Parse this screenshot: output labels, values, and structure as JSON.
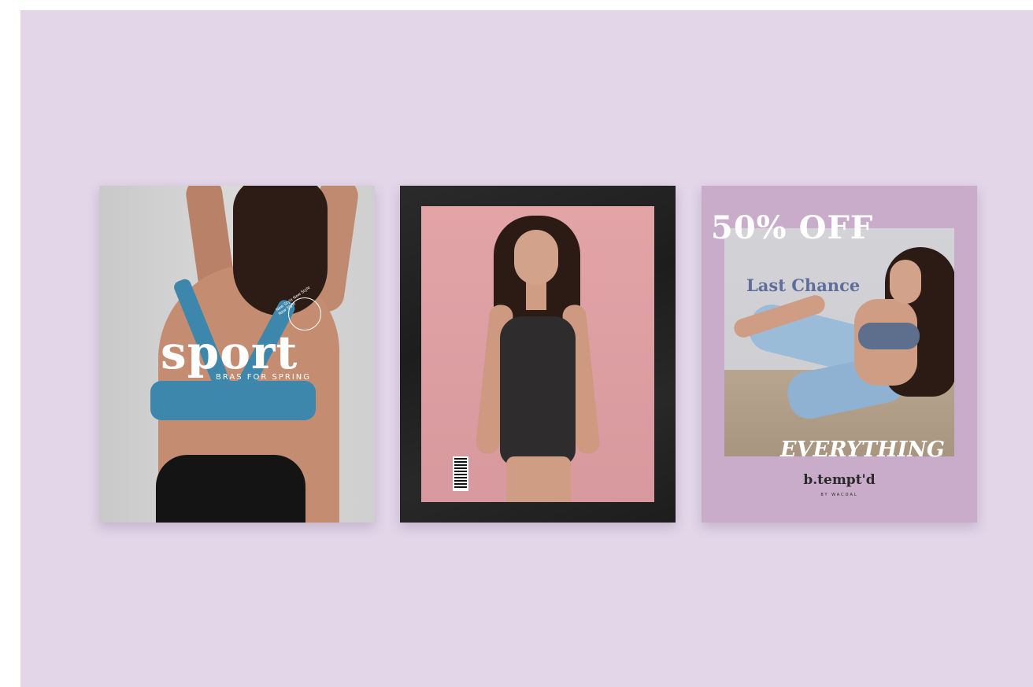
{
  "poster_sport": {
    "title": "sport",
    "subtitle": "BRAS FOR SPRING",
    "ring_text": "New Style New Style New Style"
  },
  "poster_sale": {
    "headline": "50% OFF",
    "tagline": "Last Chance",
    "banner": "EVERYTHING",
    "brand": "b.tempt'd",
    "brand_sub": "BY WACOAL"
  },
  "colors": {
    "backdrop": "#e3d6e9",
    "bra_blue": "#3d87ac",
    "pink_background": "#e2a4a7",
    "sale_purple": "#c8acc9",
    "tagline_blue": "#5e6d99"
  }
}
